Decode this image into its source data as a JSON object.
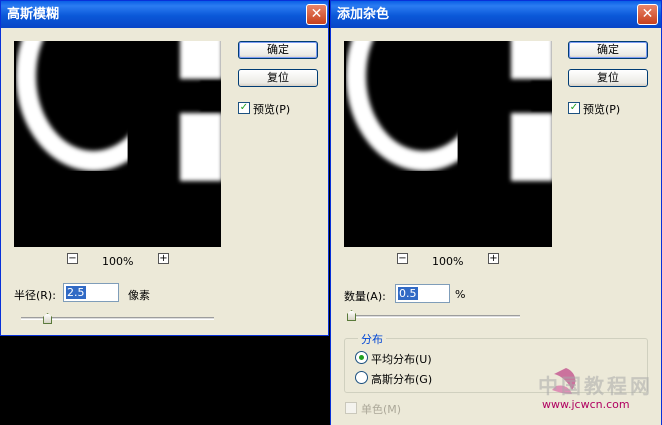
{
  "gaussian_blur": {
    "title": "高斯模糊",
    "close_glyph": "✕",
    "ok_label": "确定",
    "reset_label": "复位",
    "preview_label": "预览(P)",
    "preview_checked": true,
    "zoom_minus": "−",
    "zoom_plus": "+",
    "zoom_level": "100%",
    "radius_label": "半径(R):",
    "radius_value": "2.5",
    "radius_unit": "像素",
    "radius_slider_fraction": 0.12
  },
  "add_noise": {
    "title": "添加杂色",
    "close_glyph": "✕",
    "ok_label": "确定",
    "reset_label": "复位",
    "preview_label": "预览(P)",
    "preview_checked": true,
    "zoom_minus": "−",
    "zoom_plus": "+",
    "zoom_level": "100%",
    "amount_label": "数量(A):",
    "amount_value": "0.5",
    "amount_unit": "%",
    "amount_slider_fraction": 0.0,
    "distribution_group_label": "分布",
    "uniform_label": "平均分布(U)",
    "uniform_selected": true,
    "gaussian_label": "高斯分布(G)",
    "gaussian_selected": false,
    "monochrome_label": "单色(M)",
    "monochrome_checked": false
  },
  "watermark": {
    "cn_text": "中国教程网",
    "url_text": "www.jcwcn.com"
  },
  "colors": {
    "dialog_bg": "#ece9d8",
    "titlebar_blue": "#0a58d8",
    "close_red": "#c7401c",
    "check_green": "#21a121"
  }
}
